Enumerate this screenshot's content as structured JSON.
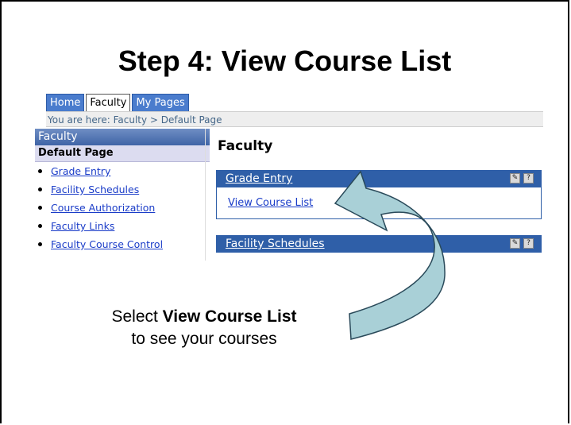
{
  "slide": {
    "title": "Step 4: View Course List"
  },
  "tabs": [
    {
      "label": "Home"
    },
    {
      "label": "Faculty"
    },
    {
      "label": "My Pages"
    }
  ],
  "breadcrumb": "You are here:  Faculty > Default Page",
  "sidebar": {
    "header": "Faculty",
    "sub": "Default Page",
    "items": [
      {
        "label": "Grade Entry"
      },
      {
        "label": "Facility Schedules"
      },
      {
        "label": "Course Authorization"
      },
      {
        "label": "Faculty Links"
      },
      {
        "label": "Faculty Course Control"
      }
    ]
  },
  "content": {
    "title": "Faculty",
    "portlets": [
      {
        "title": "Grade Entry",
        "link": "View Course List"
      },
      {
        "title": "Facility Schedules"
      }
    ],
    "icons": [
      "edit-icon",
      "help-icon"
    ]
  },
  "caption": {
    "pre": "Select ",
    "bold": "View Course List",
    "line2": "to see your courses"
  },
  "colors": {
    "tab_blue": "#4a7ccd",
    "portlet_blue": "#2f5fa8",
    "link_blue": "#1a3cc8",
    "arrow_fill": "#a9d0d7"
  }
}
